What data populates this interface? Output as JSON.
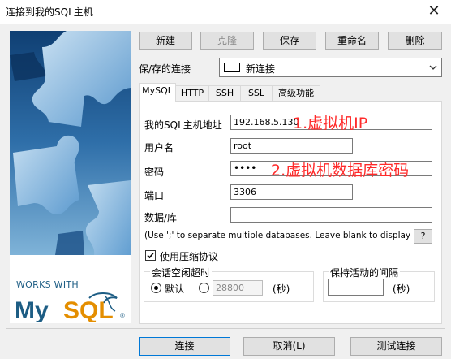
{
  "window": {
    "title": "连接到我的SQL主机",
    "close_glyph": "✕"
  },
  "branding": {
    "works_with": "WORKS WITH",
    "logo_text": "MySQL",
    "logo_reg": "®",
    "colors": {
      "my": "#1d5d84",
      "sql": "#e48e00"
    }
  },
  "toolbar": {
    "new": "新建",
    "clone": "克隆",
    "save": "保存",
    "rename": "重命名",
    "delete": "删除"
  },
  "saved_connection": {
    "label": "保/存的连接",
    "value": "新连接"
  },
  "tabs": [
    "MySQL",
    "HTTP",
    "SSH",
    "SSL",
    "高级功能"
  ],
  "active_tab": "MySQL",
  "form": {
    "host_label": "我的SQL主机地址",
    "host_value": "192.168.5.130",
    "user_label": "用户名",
    "user_value": "root",
    "password_label": "密码",
    "password_value": "••••",
    "port_label": "端口",
    "port_value": "3306",
    "database_label": "数据/库",
    "database_value": "",
    "database_hint": "(Use ';' to separate multiple databases. Leave blank to display all)",
    "help_button": "?",
    "compression_label": "使用压缩协议",
    "compression_checked": true
  },
  "session_timeout": {
    "label": "会话空闲超时",
    "default_label": "默认",
    "custom_value": "28800",
    "unit": "(秒)"
  },
  "keepalive": {
    "label": "保持活动的间隔",
    "value": "",
    "unit": "(秒)"
  },
  "annotations": {
    "host_note": "1.虚拟机IP",
    "password_note": "2.虚拟机数据库密码"
  },
  "footer": {
    "connect": "连接",
    "cancel": "取消(L)",
    "test": "测试连接"
  }
}
